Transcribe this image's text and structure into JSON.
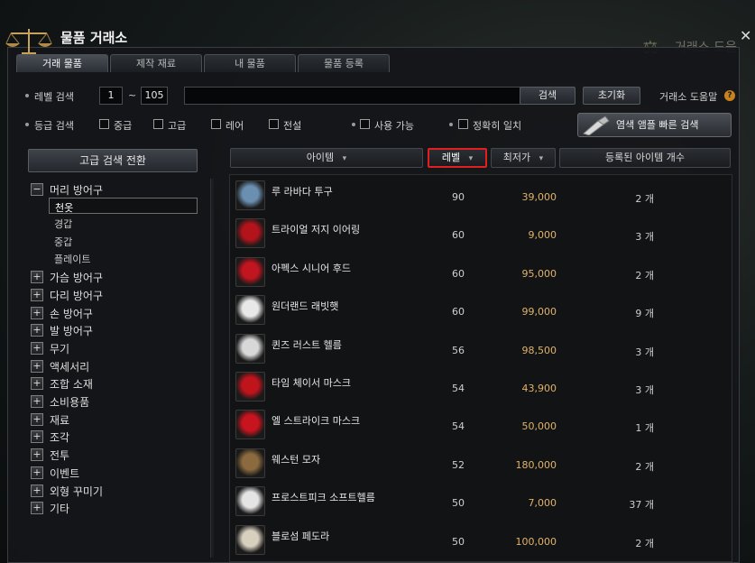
{
  "window": {
    "title": "물품 거래소",
    "background_title": "거래소 도움"
  },
  "tabs": [
    "거래 물품",
    "제작 재료",
    "내 물품",
    "물품 등록"
  ],
  "level_search": {
    "label": "레벨 검색",
    "min": "1",
    "sep": "~",
    "max": "105"
  },
  "search": {
    "value": "",
    "search_button": "검색",
    "reset_button": "초기화",
    "help_label": "거래소 도움말"
  },
  "grade": {
    "label": "등급 검색",
    "options": [
      "중급",
      "고급",
      "레어",
      "전설"
    ],
    "usable_label": "사용 가능",
    "exact_label": "정확히 일치",
    "lamp_button": "염색 앰플 빠른 검색"
  },
  "advanced_button": "고급 검색 전환",
  "categories": {
    "head": {
      "label": "머리 방어구",
      "toggle": "−",
      "subs": [
        "천옷",
        "경갑",
        "중갑",
        "플레이트"
      ]
    },
    "others": [
      "가슴 방어구",
      "다리 방어구",
      "손 방어구",
      "발 방어구",
      "무기",
      "액세서리",
      "조합 소재",
      "소비용품",
      "재료",
      "조각",
      "전투",
      "이벤트",
      "외형 꾸미기",
      "기타"
    ],
    "toggle": "+"
  },
  "columns": {
    "item": "아이템",
    "level": "레벨",
    "min_price": "최저가",
    "count": "등록된 아이템 개수"
  },
  "items": [
    {
      "name": "루 라바다 투구",
      "level": "90",
      "price": "39,000",
      "count": "2 개",
      "icon": "helmet-icon",
      "color": "#6a8fb0"
    },
    {
      "name": "트라이얼 저지 이어링",
      "level": "60",
      "price": "9,000",
      "count": "3 개",
      "icon": "earring-icon",
      "color": "#b3141c"
    },
    {
      "name": "아펙스 시니어 후드",
      "level": "60",
      "price": "95,000",
      "count": "2 개",
      "icon": "hood-icon",
      "color": "#c1151f"
    },
    {
      "name": "원더랜드 래빗햇",
      "level": "60",
      "price": "99,000",
      "count": "9 개",
      "icon": "rabbit-hat-icon",
      "color": "#e8e8e8"
    },
    {
      "name": "퀸즈 러스트 헬름",
      "level": "56",
      "price": "98,500",
      "count": "3 개",
      "icon": "horned-helm-icon",
      "color": "#d8d8d8"
    },
    {
      "name": "타임 체이서 마스크",
      "level": "54",
      "price": "43,900",
      "count": "3 개",
      "icon": "mask-icon",
      "color": "#c0141d"
    },
    {
      "name": "엘 스트라이크 마스크",
      "level": "54",
      "price": "50,000",
      "count": "1 개",
      "icon": "strike-mask-icon",
      "color": "#c8141e"
    },
    {
      "name": "웨스턴 모자",
      "level": "52",
      "price": "180,000",
      "count": "2 개",
      "icon": "western-hat-icon",
      "color": "#8a6a3e"
    },
    {
      "name": "프로스트피크 소프트헬름",
      "level": "50",
      "price": "7,000",
      "count": "37 개",
      "icon": "frost-helm-icon",
      "color": "#e4e4e4"
    },
    {
      "name": "블로섬 페도라",
      "level": "50",
      "price": "100,000",
      "count": "2 개",
      "icon": "fedora-icon",
      "color": "#d8d0bf"
    }
  ]
}
